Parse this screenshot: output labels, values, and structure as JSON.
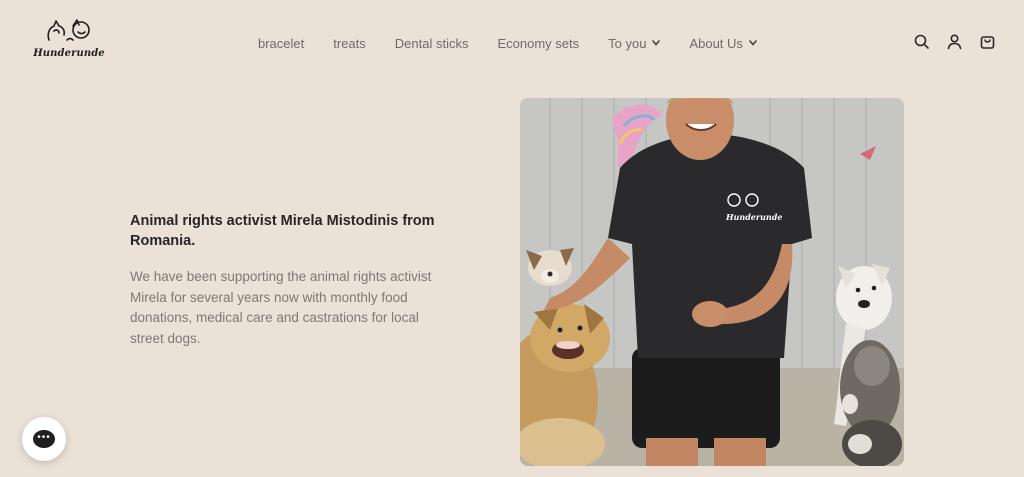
{
  "header": {
    "logo_text": "Hunderunde",
    "nav": [
      {
        "label": "bracelet",
        "has_dropdown": false
      },
      {
        "label": "treats",
        "has_dropdown": false
      },
      {
        "label": "Dental sticks",
        "has_dropdown": false
      },
      {
        "label": "Economy sets",
        "has_dropdown": false
      },
      {
        "label": "To you",
        "has_dropdown": true
      },
      {
        "label": "About Us",
        "has_dropdown": true
      }
    ],
    "icons": [
      "search-icon",
      "account-icon",
      "cart-icon"
    ]
  },
  "hero": {
    "title": "Animal rights activist Mirela Mistodinis from Romania.",
    "body": "We have been supporting the animal rights activist Mirela for several years now with monthly food donations, medical care and castrations for local street dogs.",
    "image_alt": "Mirela smiling among several street dogs",
    "shirt_logo_text": "Hunderunde"
  },
  "chat_widget": {
    "icon": "chat-icon"
  },
  "colors": {
    "background": "#ece1d7",
    "text_dark": "#262626",
    "text_muted": "#7d7975",
    "nav_text": "#6e6b68"
  }
}
